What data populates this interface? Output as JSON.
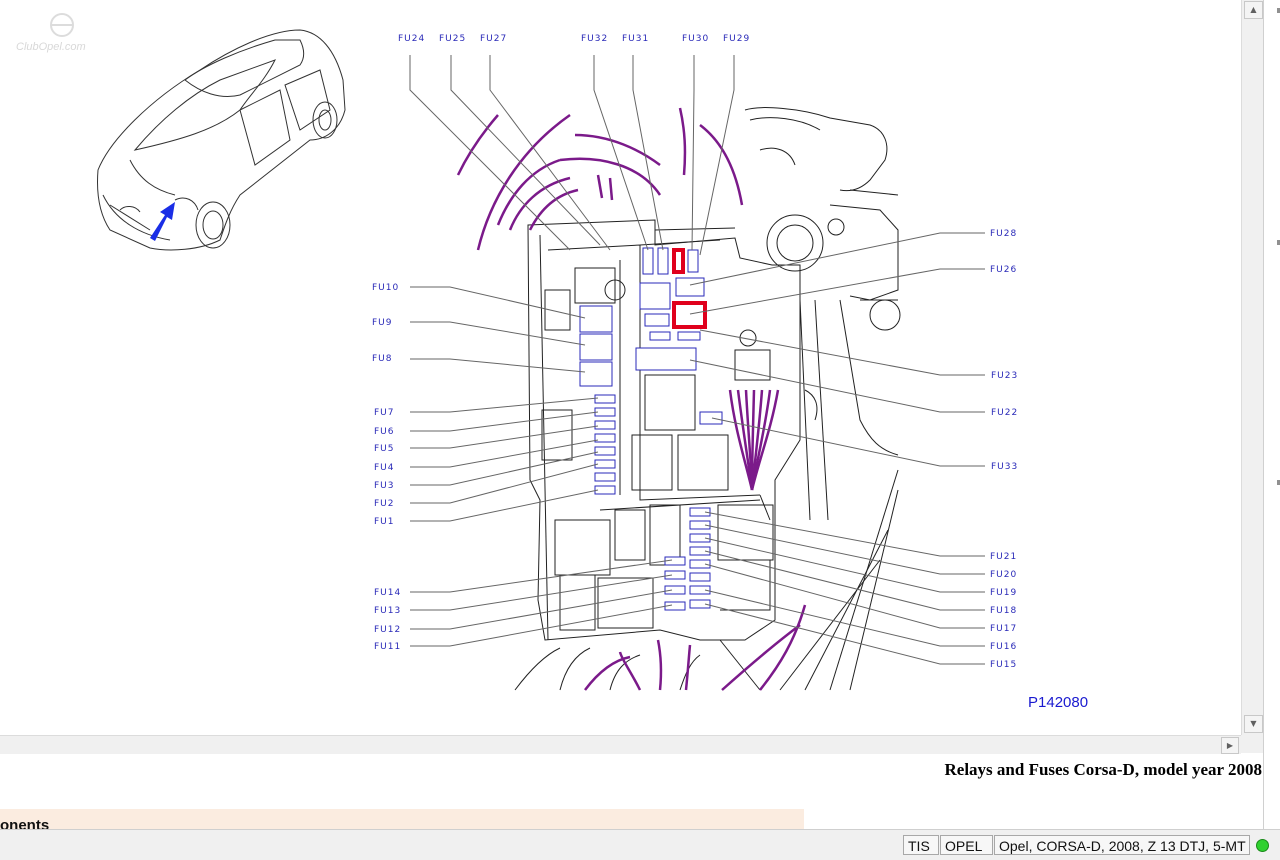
{
  "watermark": "ClubOpel.com",
  "diagram": {
    "code": "P142080",
    "labels_top": [
      "FU24",
      "FU25",
      "FU27",
      "FU32",
      "FU31",
      "FU30",
      "FU29"
    ],
    "labels_left": [
      "FU10",
      "FU9",
      "FU8",
      "FU7",
      "FU6",
      "FU5",
      "FU4",
      "FU3",
      "FU2",
      "FU1",
      "FU14",
      "FU13",
      "FU12",
      "FU11"
    ],
    "labels_right": [
      "FU28",
      "FU26",
      "FU23",
      "FU22",
      "FU33",
      "FU21",
      "FU20",
      "FU19",
      "FU18",
      "FU17",
      "FU16",
      "FU15"
    ]
  },
  "document": {
    "title": "Relays and Fuses Corsa-D, model year 2008",
    "section_partial": "onents"
  },
  "statusbar": {
    "app": "TIS",
    "make": "OPEL",
    "vehicle": "Opel, CORSA-D, 2008, Z 13 DTJ, 5-MT"
  },
  "colors": {
    "label_blue": "#2a2ab8",
    "wire_purple": "#7b1a8a",
    "highlight_red": "#e0001c",
    "arrow_blue": "#1a2ee6",
    "status_green": "#2fd12f"
  }
}
